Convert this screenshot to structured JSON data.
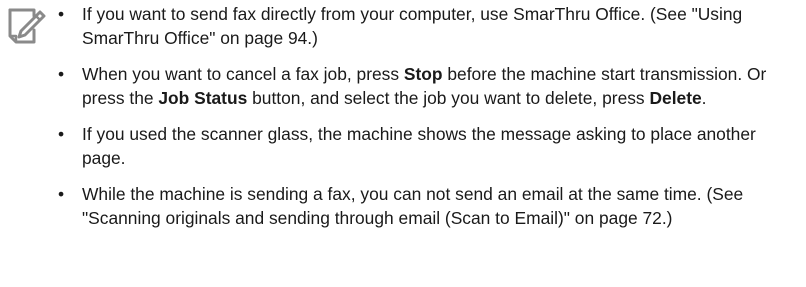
{
  "notes": [
    {
      "text": "If you want to send fax directly from your computer, use SmarThru Office. (See \"Using SmarThru Office\" on page 94.)"
    },
    {
      "segments": [
        "When you want to cancel a fax job, press ",
        "Stop",
        " before the machine start transmission. Or press the ",
        "Job Status",
        " button, and select the job you want to delete, press ",
        "Delete",
        "."
      ]
    },
    {
      "text": "If you used the scanner glass, the machine shows the message asking to place another page."
    },
    {
      "text": "While the machine is sending a fax, you can not send an email at the same time. (See \"Scanning originals and sending through email (Scan to Email)\" on page 72.)"
    }
  ],
  "bullet_symbol": "•",
  "icons": {
    "note": "pencil-note-icon"
  },
  "colors": {
    "text": "#1a1a1a",
    "icon": "#8a8a8a"
  }
}
